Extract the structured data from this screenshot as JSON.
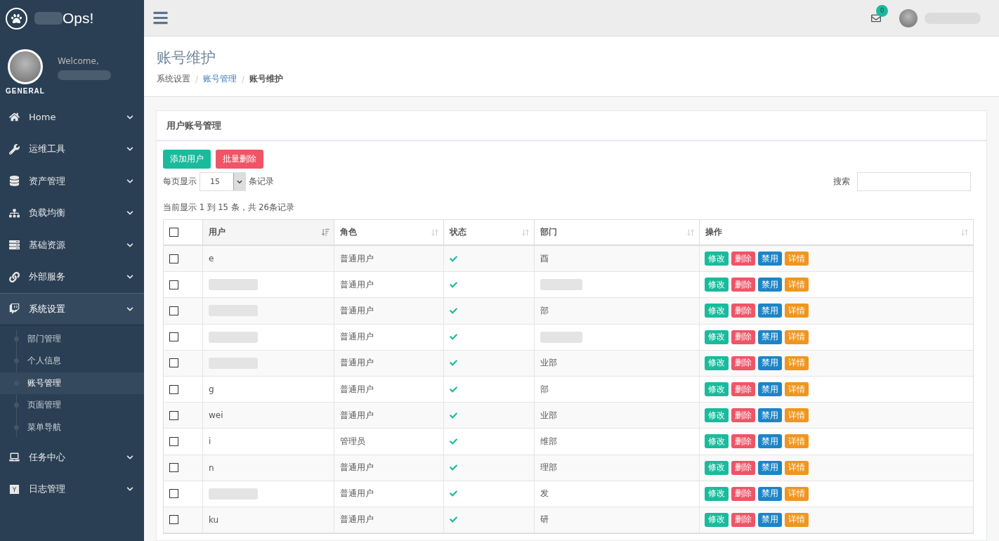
{
  "brand": {
    "name": "Ops!"
  },
  "profile": {
    "greeting": "Welcome,",
    "role": "GENERAL"
  },
  "menu": [
    {
      "label": "Home",
      "kind": "home",
      "expanded": false
    },
    {
      "label": "运维工具",
      "kind": "wrench",
      "expanded": false
    },
    {
      "label": "资产管理",
      "kind": "database",
      "expanded": false
    },
    {
      "label": "负载均衡",
      "kind": "sitemap",
      "expanded": false
    },
    {
      "label": "基础资源",
      "kind": "server",
      "expanded": false
    },
    {
      "label": "外部服务",
      "kind": "link",
      "expanded": false
    },
    {
      "label": "系统设置",
      "kind": "chat",
      "expanded": true,
      "children": [
        {
          "label": "部门管理",
          "selected": false
        },
        {
          "label": "个人信息",
          "selected": false
        },
        {
          "label": "账号管理",
          "selected": true
        },
        {
          "label": "页面管理",
          "selected": false
        },
        {
          "label": "菜单导航",
          "selected": false
        }
      ]
    },
    {
      "label": "任务中心",
      "kind": "laptop",
      "expanded": false
    },
    {
      "label": "日志管理",
      "kind": "ybox",
      "expanded": false
    }
  ],
  "topbar": {
    "mail_count": "0"
  },
  "page": {
    "title": "账号维护",
    "breadcrumb": [
      {
        "label": "系统设置",
        "kind": "text"
      },
      {
        "label": "/",
        "kind": "separator"
      },
      {
        "label": "账号管理",
        "kind": "link"
      },
      {
        "label": "/",
        "kind": "separator"
      },
      {
        "label": "账号维护",
        "kind": "current"
      }
    ]
  },
  "panel": {
    "title": "用户账号管理",
    "buttons": [
      {
        "label": "添加用户",
        "kind": "success"
      },
      {
        "label": "批量删除",
        "kind": "danger"
      }
    ],
    "length_before": "每页显示",
    "length_value": "15",
    "length_after": "条记录",
    "search_label": "搜索",
    "info": "当前显示 1 到 15 条，共 26条记录"
  },
  "table": {
    "all_checked": false,
    "columns": [
      {
        "label": "用户",
        "sorted": true
      },
      {
        "label": "角色",
        "sorted": false
      },
      {
        "label": "状态",
        "sorted": false
      },
      {
        "label": "部门",
        "sorted": false
      },
      {
        "label": "操作",
        "sorted": false
      }
    ],
    "rows": [
      {
        "checked": false,
        "user": "e",
        "role": "普通用户",
        "active": true,
        "department": "酉",
        "actions": [
          "修改",
          "删除",
          "禁用",
          "详情"
        ]
      },
      {
        "checked": false,
        "user": "",
        "role": "普通用户",
        "active": true,
        "department": "",
        "actions": [
          "修改",
          "删除",
          "禁用",
          "详情"
        ]
      },
      {
        "checked": false,
        "user": "",
        "role": "普通用户",
        "active": true,
        "department": "部",
        "actions": [
          "修改",
          "删除",
          "禁用",
          "详情"
        ]
      },
      {
        "checked": false,
        "user": "",
        "role": "普通用户",
        "active": true,
        "department": "",
        "actions": [
          "修改",
          "删除",
          "禁用",
          "详情"
        ]
      },
      {
        "checked": false,
        "user": "",
        "role": "普通用户",
        "active": true,
        "department": "业部",
        "actions": [
          "修改",
          "删除",
          "禁用",
          "详情"
        ]
      },
      {
        "checked": false,
        "user": "g",
        "role": "普通用户",
        "active": true,
        "department": "部",
        "actions": [
          "修改",
          "删除",
          "禁用",
          "详情"
        ]
      },
      {
        "checked": false,
        "user": "wei",
        "role": "普通用户",
        "active": true,
        "department": "业部",
        "actions": [
          "修改",
          "删除",
          "禁用",
          "详情"
        ]
      },
      {
        "checked": false,
        "user": "i",
        "role": "管理员",
        "active": true,
        "department": "维部",
        "actions": [
          "修改",
          "删除",
          "禁用",
          "详情"
        ]
      },
      {
        "checked": false,
        "user": "n",
        "role": "普通用户",
        "active": true,
        "department": "理部",
        "actions": [
          "修改",
          "删除",
          "禁用",
          "详情"
        ]
      },
      {
        "checked": false,
        "user": "",
        "role": "普通用户",
        "active": true,
        "department": "发",
        "actions": [
          "修改",
          "删除",
          "禁用",
          "详情"
        ]
      },
      {
        "checked": false,
        "user": "ku",
        "role": "普通用户",
        "active": true,
        "department": "研",
        "actions": [
          "修改",
          "删除",
          "禁用",
          "详情"
        ]
      }
    ]
  }
}
